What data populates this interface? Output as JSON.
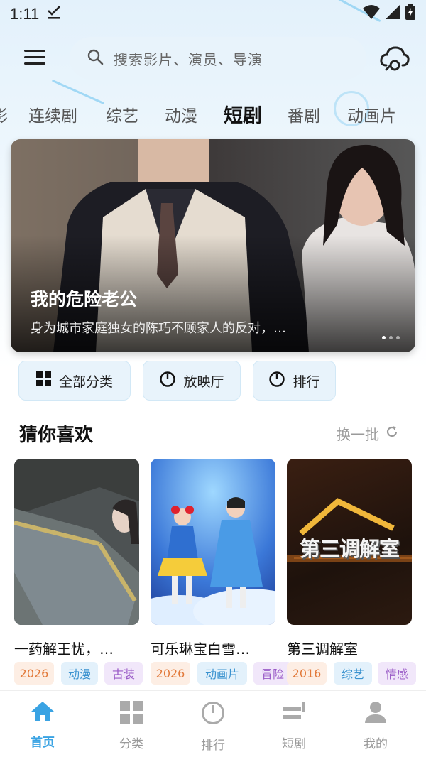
{
  "status_bar": {
    "time": "1:11"
  },
  "header": {
    "search_placeholder": "搜索影片、演员、导演"
  },
  "categories": {
    "partial_left": "影",
    "items": [
      "连续剧",
      "综艺",
      "动漫",
      "短剧",
      "番剧",
      "动画片"
    ],
    "active": "短剧"
  },
  "banner": {
    "title": "我的危险老公",
    "description": "身为城市家庭独女的陈巧不顾家人的反对，…",
    "slide_count": 3,
    "active_slide": 1
  },
  "quick_links": {
    "all_categories": "全部分类",
    "cinema": "放映厅",
    "ranking": "排行"
  },
  "recommend": {
    "title": "猜你喜欢",
    "refresh_label": "换一批",
    "cards": [
      {
        "name": "一药解王忧，…",
        "tags": [
          "2026",
          "动漫",
          "古装"
        ]
      },
      {
        "name": "可乐琳宝白雪…",
        "tags": [
          "2026",
          "动画片",
          "冒险"
        ]
      },
      {
        "name": "第三调解室",
        "poster_text": "第三调解室",
        "tags": [
          "2016",
          "综艺",
          "情感"
        ]
      }
    ]
  },
  "bottom_nav": {
    "items": [
      "首页",
      "分类",
      "排行",
      "短剧",
      "我的"
    ],
    "active": "首页"
  },
  "colors": {
    "accent": "#3aa3e3",
    "tag_year": "#e2793a",
    "tag_type": "#3a92cf",
    "tag_genre": "#9a5bc7"
  }
}
